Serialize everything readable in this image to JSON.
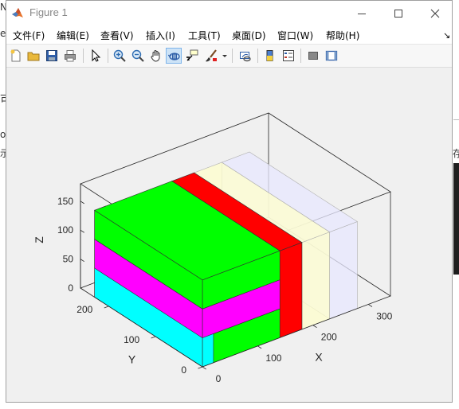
{
  "window": {
    "title": "Figure 1",
    "controls": {
      "minimize": "minimize",
      "maximize": "maximize",
      "close": "close"
    }
  },
  "menu": [
    "文件(F)",
    "编辑(E)",
    "查看(V)",
    "插入(I)",
    "工具(T)",
    "桌面(D)",
    "窗口(W)",
    "帮助(H)"
  ],
  "toolbar": {
    "buttons": [
      "new-figure",
      "open-file",
      "save",
      "print",
      "edit-plot",
      "zoom-in",
      "zoom-out",
      "pan",
      "rotate-3d",
      "data-cursor",
      "brush",
      "link-plot",
      "insert-colorbar",
      "insert-legend",
      "hide-plot-tools",
      "show-plot-tools"
    ],
    "active": "rotate-3d"
  },
  "background_fragments": [
    "et",
    "可",
    "o",
    "示",
    "存",
    "N"
  ],
  "chart_data": {
    "type": "3d-bar",
    "title": "",
    "xlabel": "X",
    "ylabel": "Y",
    "zlabel": "Z",
    "x_ticks": [
      "0",
      "100",
      "200",
      "300"
    ],
    "y_ticks": [
      "0",
      "100",
      "200"
    ],
    "z_ticks": [
      "0",
      "50",
      "100",
      "150"
    ],
    "xlim": [
      0,
      340
    ],
    "ylim": [
      0,
      260
    ],
    "zlim": [
      0,
      180
    ],
    "boxes": [
      {
        "color": "#00ff00",
        "x": [
          0,
          140
        ],
        "y": [
          0,
          230
        ],
        "z": [
          0,
          50
        ]
      },
      {
        "color": "#ff00ff",
        "x": [
          0,
          140
        ],
        "y": [
          0,
          230
        ],
        "z": [
          50,
          100
        ]
      },
      {
        "color": "#00ff00",
        "x": [
          0,
          140
        ],
        "y": [
          0,
          230
        ],
        "z": [
          100,
          150
        ]
      },
      {
        "color": "#00ffff",
        "x": [
          0,
          20
        ],
        "y": [
          0,
          230
        ],
        "z": [
          0,
          150
        ]
      },
      {
        "color": "#ff0000",
        "x": [
          140,
          180
        ],
        "y": [
          0,
          230
        ],
        "z": [
          0,
          150
        ]
      },
      {
        "color": "#ffffcc",
        "x": [
          180,
          230
        ],
        "y": [
          0,
          230
        ],
        "z": [
          0,
          150
        ]
      },
      {
        "color": "#e8e8ff",
        "x": [
          230,
          280
        ],
        "y": [
          0,
          230
        ],
        "z": [
          0,
          150
        ]
      }
    ]
  }
}
